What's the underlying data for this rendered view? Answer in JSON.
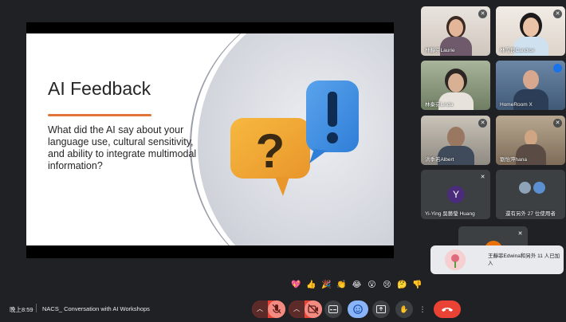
{
  "slide": {
    "title": "AI Feedback",
    "body": "What did the AI say about your language use, cultural sensitivity, and ability to integrate multimodal information?"
  },
  "participants": [
    {
      "name": "林靜芬Laurie",
      "muted": true
    },
    {
      "name": "林雪良Candice",
      "muted": true
    },
    {
      "name": "林秦芬Linda",
      "muted": false
    },
    {
      "name": "HomeRoom X",
      "muted": false,
      "speaking": true
    },
    {
      "name": "洪季若Albert",
      "muted": true
    },
    {
      "name": "劉怡萍hana",
      "muted": true
    },
    {
      "name": "Yi-Ying 吳藝瑩 Huang",
      "muted": true,
      "avatar_letter": "Y"
    },
    {
      "name": "還有另外 27 位使用者"
    }
  ],
  "toast": {
    "text": "王靜菲Edwina和另外 11 人已加入"
  },
  "reactions": [
    "💖",
    "👍",
    "🎉",
    "👏",
    "😂",
    "😮",
    "😢",
    "🤔",
    "👎"
  ],
  "bottom_bar": {
    "time": "晚上8:59",
    "meeting_title": "NACS_ Conversation with AI Workshops"
  },
  "colors": {
    "accent_orange": "#e0743a",
    "hang_up": "#ea4335",
    "active_blue": "#8ab4f8",
    "muted_red": "#f28b82"
  }
}
